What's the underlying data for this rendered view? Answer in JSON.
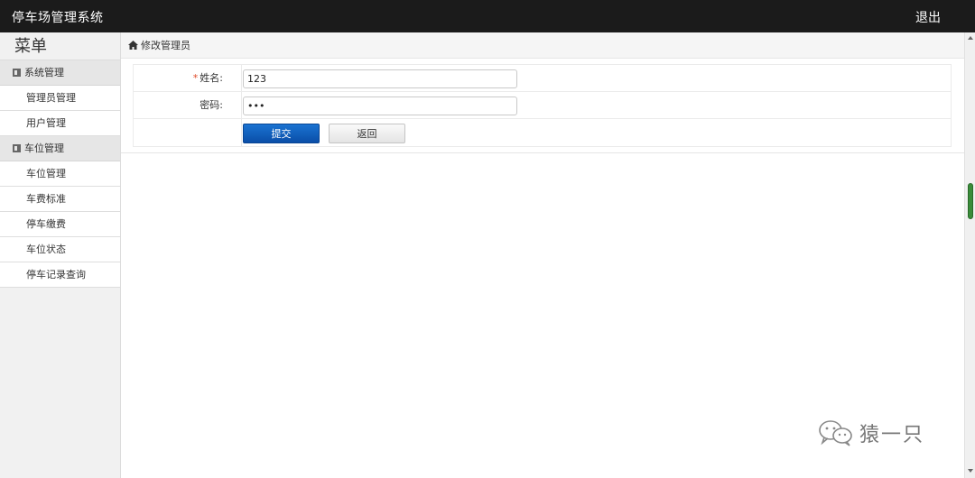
{
  "app": {
    "title": "停车场管理系统",
    "logout_label": "退出"
  },
  "sidebar": {
    "menu_label": "菜单",
    "groups": [
      {
        "label": "系统管理",
        "items": [
          "管理员管理",
          "用户管理"
        ]
      },
      {
        "label": "车位管理",
        "items": [
          "车位管理",
          "车费标准",
          "停车缴费",
          "车位状态",
          "停车记录查询"
        ]
      }
    ]
  },
  "breadcrumb": {
    "label": "修改管理员",
    "icon": "home-icon"
  },
  "form": {
    "name_required_mark": "*",
    "name_label": "姓名:",
    "name_value": "123",
    "password_label": "密码:",
    "password_value": "123",
    "submit_label": "提交",
    "back_label": "返回"
  },
  "watermark": {
    "text": "猿一只",
    "icon": "wechat-icon"
  },
  "colors": {
    "topbar": "#1b1b1b",
    "primary_button": "#0a4ea8",
    "required": "#e04b2a",
    "scroll_thumb": "#3a8c3a"
  }
}
